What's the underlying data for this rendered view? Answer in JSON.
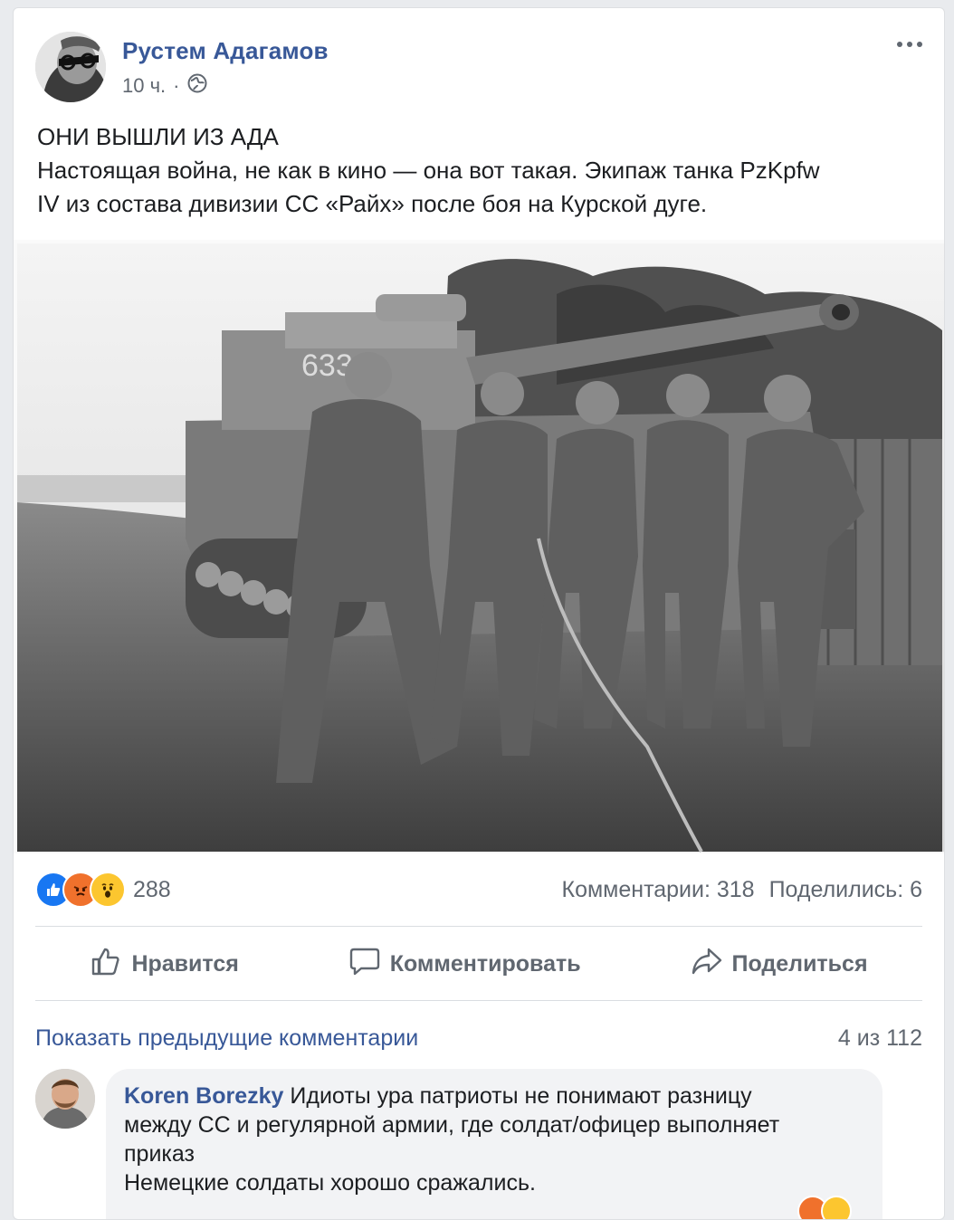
{
  "post": {
    "author": "Рустем Адагамов",
    "time": "10 ч.",
    "separator": "·",
    "text_lines": [
      "ОНИ ВЫШЛИ ИЗ АДА",
      "Настоящая война, не как в кино — она вот такая. Экипаж танка PzKpfw",
      "IV из состава дивизии СС «Райх» после боя на Курской дуге."
    ],
    "reactions_count": "288",
    "comments_stat": "Комментарии: 318",
    "shares_stat": "Поделились: 6",
    "reaction_icons": [
      "like-icon",
      "angry-icon",
      "wow-icon"
    ]
  },
  "actions": {
    "like_label": "Нравится",
    "comment_label": "Комментировать",
    "share_label": "Поделиться"
  },
  "comments": {
    "show_previous": "Показать предыдущие комментарии",
    "count_label": "4 из 112",
    "first": {
      "author": "Koren Borezky",
      "lines": [
        " Идиоты ура патриоты не понимают разницу",
        "между СС и регулярной армии, где солдат/офицер выполняет",
        "приказ",
        "Немецкие солдаты хорошо сражались."
      ]
    }
  },
  "colors": {
    "link": "#385898",
    "muted": "#606770",
    "like_blue": "#1877f2",
    "angry_orange": "#f0712c",
    "wow_yellow": "#fcc62f"
  }
}
